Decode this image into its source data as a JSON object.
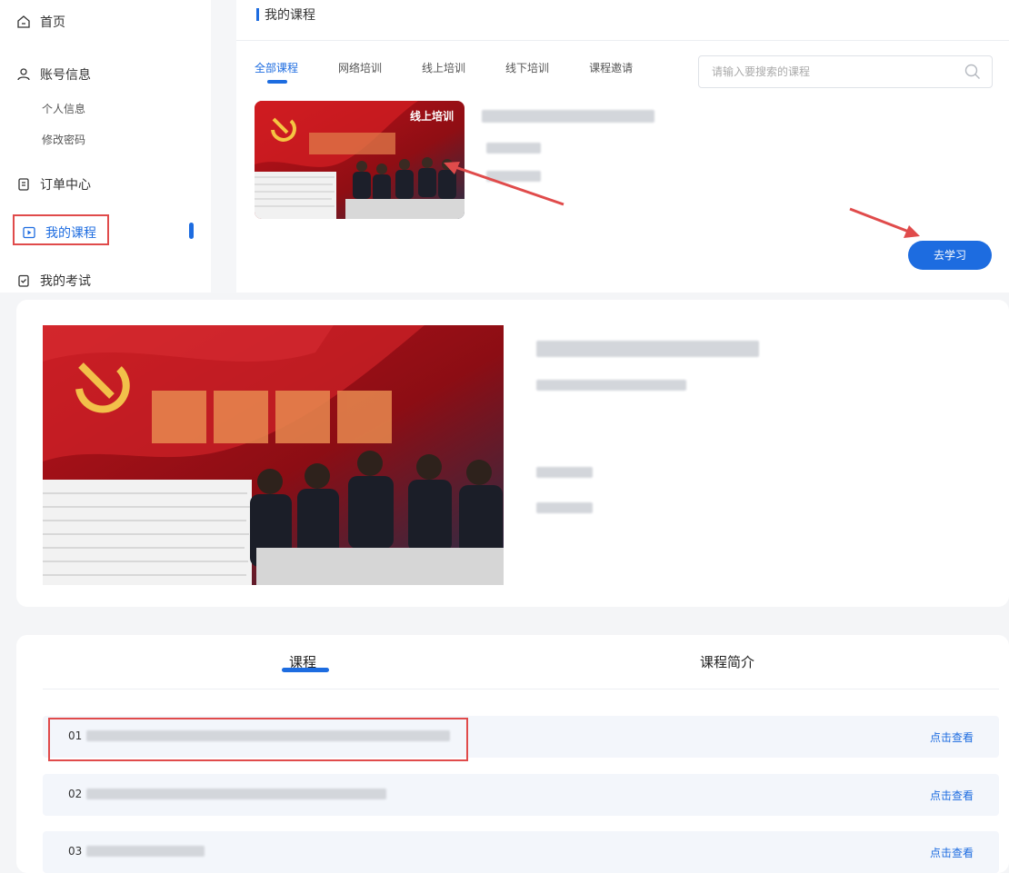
{
  "sidebar": {
    "items": [
      {
        "label": "首页",
        "icon": "home-icon"
      },
      {
        "label": "账号信息",
        "icon": "user-icon"
      },
      {
        "label": "订单中心",
        "icon": "order-icon"
      },
      {
        "label": "我的课程",
        "icon": "course-play-icon"
      },
      {
        "label": "我的考试",
        "icon": "exam-icon"
      }
    ],
    "sub_items": [
      "个人信息",
      "修改密码"
    ]
  },
  "main": {
    "title": "我的课程",
    "tabs": [
      "全部课程",
      "网络培训",
      "线上培训",
      "线下培训",
      "课程邀请"
    ],
    "search_placeholder": "请输入要搜索的课程",
    "card_badge": "线上培训",
    "study_button": "去学习"
  },
  "detail": {
    "tabs": [
      "课程",
      "课程简介"
    ],
    "lessons": [
      {
        "number": "01",
        "link": "点击查看"
      },
      {
        "number": "02",
        "link": "点击查看"
      },
      {
        "number": "03",
        "link": "点击查看"
      }
    ]
  },
  "colors": {
    "accent": "#1d6ce0",
    "highlight": "#e04b4b",
    "background": "#f4f5f7"
  }
}
